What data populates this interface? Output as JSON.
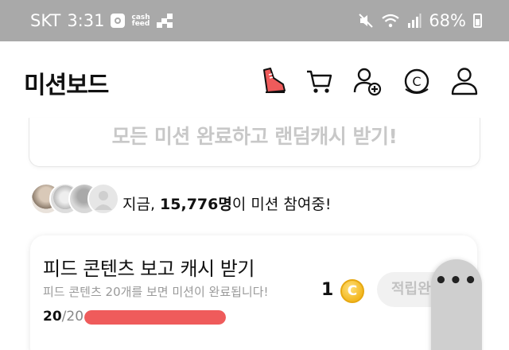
{
  "status_bar": {
    "carrier": "SKT",
    "time": "3:31",
    "cashfeed_icon": "cashfeed-icon",
    "cashfeed_text_top": "cash",
    "cashfeed_text_bottom": "feed",
    "battery": "68%"
  },
  "header": {
    "title": "미션보드",
    "icons": [
      "sneaker-icon",
      "cart-icon",
      "add-friend-icon",
      "cash-coin-icon",
      "profile-icon"
    ],
    "coin_glyph": "C"
  },
  "banner": {
    "text": "모든 미션 완료하고 랜덤캐시 받기!"
  },
  "participants": {
    "prefix": "지금, ",
    "count": "15,776명",
    "suffix": "이 미션 참여중!"
  },
  "mission": {
    "title": "피드 콘텐츠 보고 캐시 받기",
    "description": "피드 콘텐츠 20개를 보면 미션이 완료됩니다!",
    "reward_amount": "1",
    "reward_coin": "C",
    "claim_label": "적립완료",
    "progress_current": "20",
    "progress_total": "/20",
    "progress_fraction": 1.0
  },
  "floating": {
    "label": "•••"
  },
  "colors": {
    "status_bar_bg": "#a9a9a9",
    "progress_fill": "#ef5b5b",
    "coin": "#f3b820",
    "sneaker_accent": "#ef5b5b"
  }
}
